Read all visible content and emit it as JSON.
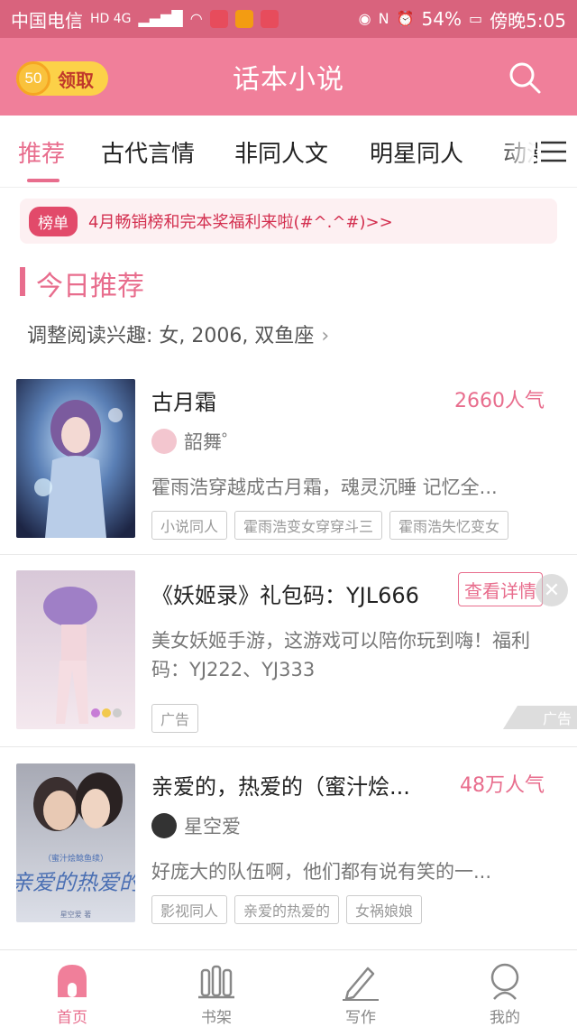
{
  "statusbar": {
    "carrier": "中国电信",
    "network": "HD 4G",
    "battery": "54%",
    "time": "傍晚5:05"
  },
  "header": {
    "title": "话本小说",
    "reward_count": "50",
    "reward_label": "领取"
  },
  "tabs": [
    {
      "label": "推荐",
      "active": true
    },
    {
      "label": "古代言情",
      "active": false
    },
    {
      "label": "非同人文",
      "active": false
    },
    {
      "label": "明星同人",
      "active": false
    },
    {
      "label": "动漫",
      "active": false
    }
  ],
  "notice": {
    "badge": "榜单",
    "text": "4月畅销榜和完本奖福利来啦(#^.^#)>>"
  },
  "section": {
    "title": "今日推荐",
    "interest": "调整阅读兴趣: 女, 2006, 双鱼座",
    "interest_chevron": "›"
  },
  "books": [
    {
      "title": "古月霜",
      "popularity": "2660人气",
      "author": "韶舞゜",
      "description": "霍雨浩穿越成古月霜，魂灵沉睡 记忆全...",
      "tags": [
        "小说同人",
        "霍雨浩变女穿穿斗三",
        "霍雨浩失忆变女"
      ]
    },
    {
      "title": "亲爱的，热爱的（蜜汁烩...",
      "popularity": "48万人气",
      "author": "星空爱",
      "description": "好庞大的队伍啊，他们都有说有笑的一...",
      "tags": [
        "影视同人",
        "亲爱的热爱的",
        "女祸娘娘"
      ],
      "cover_text": "亲爱的热爱的",
      "cover_subtext": "（蜜汁烩鲶鱼续）",
      "cover_author": "星空爱 著"
    }
  ],
  "ad": {
    "title": "《妖姬录》礼包码：YJL666",
    "button": "查看详情",
    "close": "✕",
    "description": "美女妖姬手游，这游戏可以陪你玩到嗨！福利码：YJ222、YJ333",
    "tag": "广告",
    "mark": "广告"
  },
  "bottomnav": [
    {
      "label": "首页",
      "icon": "home-icon",
      "active": true
    },
    {
      "label": "书架",
      "icon": "bookshelf-icon",
      "active": false
    },
    {
      "label": "写作",
      "icon": "pen-icon",
      "active": false
    },
    {
      "label": "我的",
      "icon": "profile-icon",
      "active": false
    }
  ],
  "colors": {
    "accent": "#e86d8d",
    "header": "#f07f9a",
    "statusbar": "#d9637d"
  }
}
